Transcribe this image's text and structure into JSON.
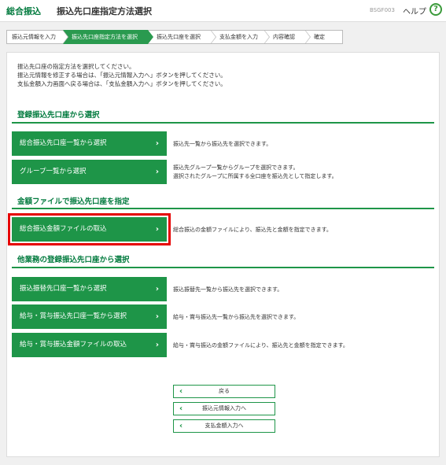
{
  "header": {
    "app_title": "総合振込",
    "page_title": "振込先口座指定方法選択",
    "screen_id": "BSGF003",
    "help_label": "ヘルプ",
    "help_icon": "?"
  },
  "steps": [
    {
      "label": "振込元情報を入力",
      "active": false
    },
    {
      "label": "振込先口座指定方法を選択",
      "active": true
    },
    {
      "label": "振込先口座を選択",
      "active": false
    },
    {
      "label": "支払金額を入力",
      "active": false
    },
    {
      "label": "内容確認",
      "active": false
    },
    {
      "label": "確定",
      "active": false
    }
  ],
  "intro": [
    "振込先口座の指定方法を選択してください。",
    "振込元情報を修正する場合は、「振込元情報入力へ」ボタンを押してください。",
    "支払金額入力画面へ戻る場合は、「支払金額入力へ」ボタンを押してください。"
  ],
  "sections": {
    "registered": {
      "title": "登録振込先口座から選択",
      "btn1": "総合振込先口座一覧から選択",
      "desc1": "振込先一覧から振込先を選択できます。",
      "btn2": "グループ一覧から選択",
      "desc2a": "振込先グループ一覧からグループを選択できます。",
      "desc2b": "選択されたグループに所属する全口座を振込先として指定します。"
    },
    "file": {
      "title": "金額ファイルで振込先口座を指定",
      "btn1": "総合振込金額ファイルの取込",
      "desc1": "総合振込の金額ファイルにより、振込先と金額を指定できます。"
    },
    "other": {
      "title": "他業務の登録振込先口座から選択",
      "btn1": "振込振替先口座一覧から選択",
      "desc1": "振込振替先一覧から振込先を選択できます。",
      "btn2": "給与・賞与振込先口座一覧から選択",
      "desc2": "給与・賞与振込先一覧から振込先を選択できます。",
      "btn3": "給与・賞与振込金額ファイルの取込",
      "desc3": "給与・賞与振込の金額ファイルにより、振込先と金額を指定できます。"
    }
  },
  "nav": {
    "back": "戻る",
    "to_source": "振込元情報入力へ",
    "to_amount": "支払金額入力へ"
  },
  "chevron_right": "›",
  "chevron_left": "‹",
  "colors": {
    "brand_green": "#1e9548",
    "highlight_red": "#e60000"
  }
}
